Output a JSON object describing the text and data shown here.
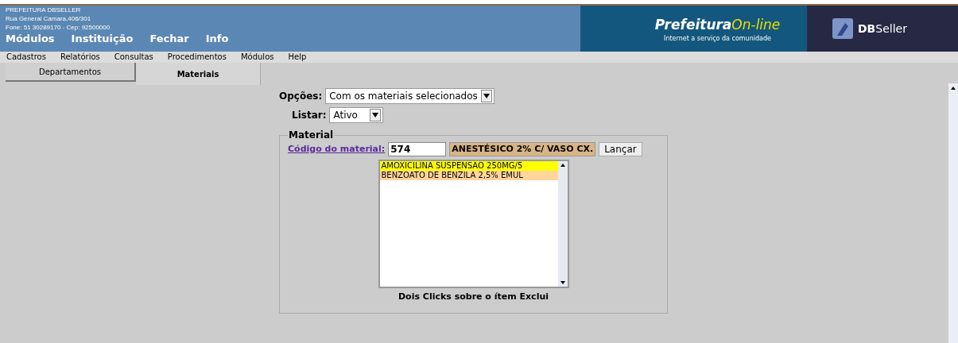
{
  "header": {
    "org_lines": [
      "PREFEITURA DBSELLER",
      "Rua General Camara,406/301",
      "Fone: 51 30289170  -  Cep: 92500000"
    ],
    "main_menu": [
      "Módulos",
      "Instituição",
      "Fechar",
      "Info"
    ],
    "logo": {
      "name": "Prefeitura",
      "suffix": "On-line",
      "tagline": "Internet a serviço da comunidade"
    },
    "brand": "**DB**Seller"
  },
  "menu_bar": [
    "Cadastros",
    "Relatórios",
    "Consultas",
    "Procedimentos",
    "Módulos",
    "Help"
  ],
  "tabs": [
    {
      "label": "Departamentos",
      "selected": false
    },
    {
      "label": "Materiais",
      "selected": true
    }
  ],
  "form": {
    "options": {
      "label": "Opções:",
      "value": "Com os materiais selecionados"
    },
    "list_filter": {
      "label": "Listar:",
      "value": "Ativo"
    },
    "material": {
      "legend": "Material",
      "code_label": "Código do material:",
      "code_value": "574",
      "description": "ANESTÉSICO 2% C/ VASO CX.",
      "button": "Lançar",
      "items": [
        {
          "text": "AMOXICILINA SUSPENSAO 250MG/5",
          "color": "#ffff00"
        },
        {
          "text": "BENZOATO DE BENZILA 2,5% EMUL",
          "color": "#ffd59a"
        }
      ],
      "hint": "Dois Clicks sobre o ítem Exclui"
    }
  }
}
